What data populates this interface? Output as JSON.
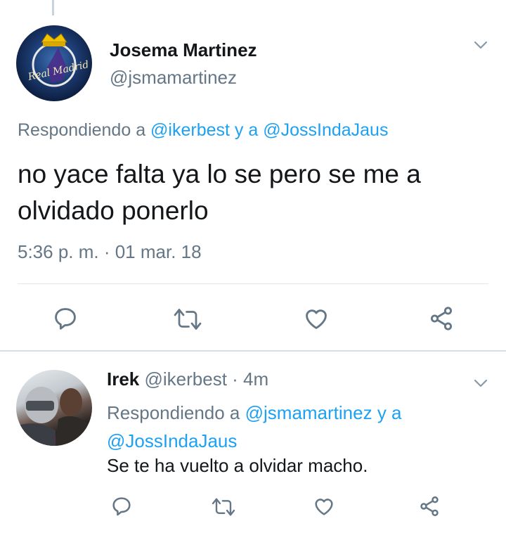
{
  "tweet": {
    "author_name": "Josema Martinez",
    "author_handle": "@jsmamartinez",
    "replying_prefix": "Respondiendo a ",
    "replying_to_1": "@ikerbest",
    "replying_join": " y a ",
    "replying_to_2": "@JossIndaJaus",
    "text": "no yace falta ya lo se pero se me a olvidado ponerlo",
    "timestamp": "5:36 p. m. · 01 mar. 18",
    "avatar_text": "Real Madrid"
  },
  "reply": {
    "author_name": "Irek",
    "author_handle": "@ikerbest",
    "age": "· 4m",
    "replying_prefix": "Respondiendo a ",
    "replying_to_1": "@jsmamartinez",
    "replying_join": " y a",
    "replying_to_2": "@JossIndaJaus",
    "text": "Se te ha vuelto a olvidar macho."
  },
  "icons": [
    "reply-icon",
    "retweet-icon",
    "like-icon",
    "share-icon",
    "chevron-down-icon"
  ],
  "colors": {
    "link": "#1da1f2",
    "muted": "#657786",
    "text": "#14171a",
    "icon": "#657786"
  }
}
